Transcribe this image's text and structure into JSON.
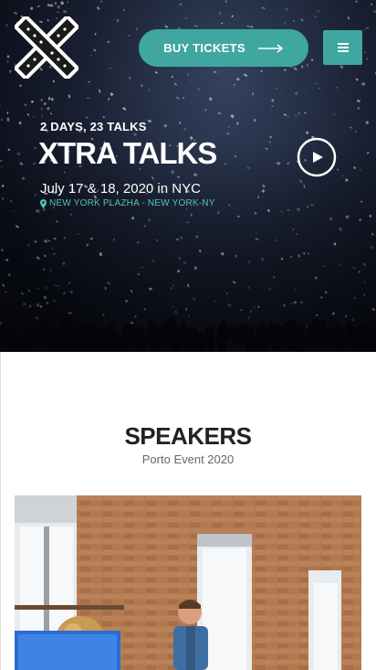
{
  "header": {
    "buy_tickets_label": "BUY TICKETS"
  },
  "hero": {
    "eyebrow": "2 DAYS, 23 TALKS",
    "title": "XTRA TALKS",
    "date": "July 17 & 18, 2020 in NYC",
    "venue": "NEW YORK PLAZHA - NEW YORK-NY"
  },
  "speakers": {
    "title": "SPEAKERS",
    "subtitle": "Porto Event 2020"
  },
  "colors": {
    "accent": "#3fa7a0",
    "venue_text": "#4fc3b8"
  },
  "icons": {
    "logo": "x-logo",
    "arrow": "long-arrow-right-icon",
    "menu": "hamburger-menu-icon",
    "location": "map-marker-icon",
    "play": "play-circle-icon"
  }
}
